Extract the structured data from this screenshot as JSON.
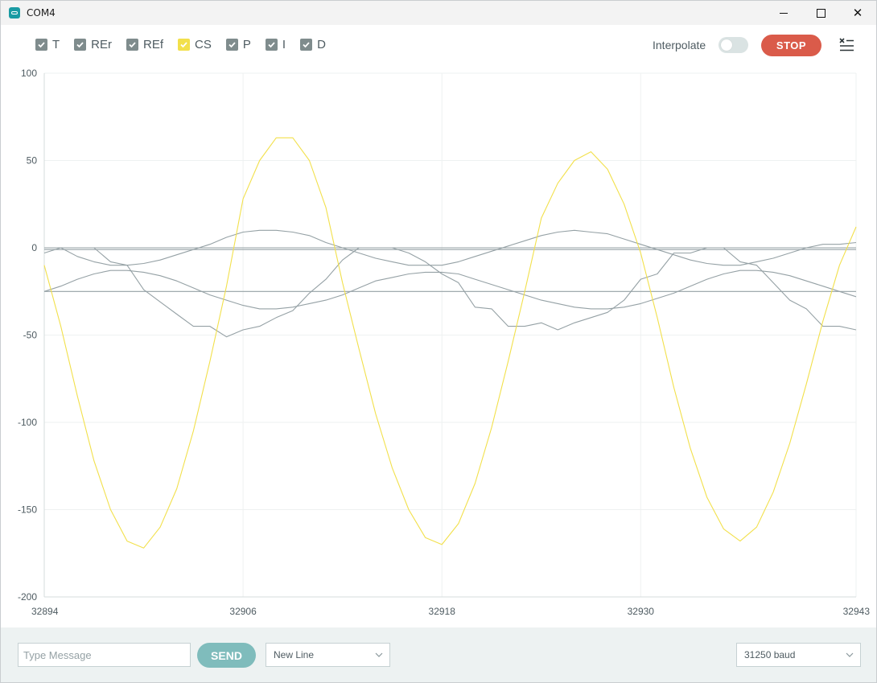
{
  "window": {
    "title": "COM4"
  },
  "legend": [
    {
      "label": "T",
      "checked": true,
      "color": "#7f8c8d"
    },
    {
      "label": "REr",
      "checked": true,
      "color": "#7f8c8d"
    },
    {
      "label": "REf",
      "checked": true,
      "color": "#7f8c8d"
    },
    {
      "label": "CS",
      "checked": true,
      "color": "#f2e04b"
    },
    {
      "label": "P",
      "checked": true,
      "color": "#7f8c8d"
    },
    {
      "label": "I",
      "checked": true,
      "color": "#7f8c8d"
    },
    {
      "label": "D",
      "checked": true,
      "color": "#7f8c8d"
    }
  ],
  "toolbar": {
    "interpolate_label": "Interpolate",
    "interpolate_on": false,
    "stop_label": "STOP"
  },
  "colors": {
    "accent_stop": "#da5b4a",
    "send": "#7fbcbc",
    "cs_line": "#f2e04b",
    "gray_line": "#95a1a5"
  },
  "bottom": {
    "message_placeholder": "Type Message",
    "send_label": "SEND",
    "line_ending": "New Line",
    "baud": "31250 baud"
  },
  "chart_data": {
    "type": "line",
    "xlim": [
      32894,
      32943
    ],
    "ylim": [
      -200,
      100
    ],
    "x_ticks": [
      "32894",
      "32906",
      "32918",
      "32930",
      "32943"
    ],
    "y_ticks": [
      "100",
      "50",
      "0",
      "-50",
      "-100",
      "-150",
      "-200"
    ],
    "grid": true,
    "series": [
      {
        "name": "CS",
        "color": "#f2e04b",
        "x": [
          32894,
          32895,
          32896,
          32897,
          32898,
          32899,
          32900,
          32901,
          32902,
          32903,
          32904,
          32905,
          32906,
          32907,
          32908,
          32909,
          32910,
          32911,
          32912,
          32913,
          32914,
          32915,
          32916,
          32917,
          32918,
          32919,
          32920,
          32921,
          32922,
          32923,
          32924,
          32925,
          32926,
          32927,
          32928,
          32929,
          32930,
          32931,
          32932,
          32933,
          32934,
          32935,
          32936,
          32937,
          32938,
          32939,
          32940,
          32941,
          32942,
          32943
        ],
        "values": [
          -10,
          -45,
          -85,
          -122,
          -150,
          -168,
          -172,
          -160,
          -138,
          -105,
          -65,
          -22,
          28,
          50,
          63,
          63,
          50,
          23,
          -20,
          -58,
          -95,
          -126,
          -150,
          -166,
          -170,
          -158,
          -135,
          -103,
          -65,
          -25,
          17,
          37,
          50,
          55,
          45,
          25,
          -3,
          -40,
          -80,
          -115,
          -143,
          -161,
          -168,
          -160,
          -140,
          -112,
          -78,
          -42,
          -10,
          12
        ],
        "note": ""
      },
      {
        "name": "T",
        "color": "#95a1a5",
        "x": [
          32894,
          32943
        ],
        "values": [
          0,
          0
        ]
      },
      {
        "name": "REr",
        "color": "#95a1a5",
        "x": [
          32894,
          32943
        ],
        "values": [
          -25,
          -25
        ]
      },
      {
        "name": "REf",
        "color": "#95a1a5",
        "x": [
          32894,
          32895,
          32896,
          32897,
          32898,
          32899,
          32900,
          32901,
          32902,
          32903,
          32904,
          32905,
          32906,
          32907,
          32908,
          32909,
          32910,
          32911,
          32912,
          32913,
          32914,
          32915,
          32916,
          32917,
          32918,
          32919,
          32920,
          32921,
          32922,
          32923,
          32924,
          32925,
          32926,
          32927,
          32928,
          32929,
          32930,
          32931,
          32932,
          32933,
          32934,
          32935,
          32936,
          32937,
          32938,
          32939,
          32940,
          32941,
          32942,
          32943
        ],
        "values": [
          -3,
          0,
          -5,
          -8,
          -10,
          -10,
          -9,
          -7,
          -4,
          -1,
          2,
          6,
          9,
          10,
          10,
          9,
          7,
          3,
          0,
          -3,
          -6,
          -8,
          -10,
          -10,
          -10,
          -8,
          -5,
          -2,
          1,
          4,
          7,
          9,
          10,
          9,
          8,
          5,
          2,
          -1,
          -4,
          -7,
          -9,
          -10,
          -10,
          -8,
          -6,
          -3,
          0,
          2,
          2,
          3
        ]
      },
      {
        "name": "P",
        "color": "#95a1a5",
        "x": [
          32894,
          32895,
          32896,
          32897,
          32898,
          32899,
          32900,
          32901,
          32902,
          32903,
          32904,
          32905,
          32906,
          32907,
          32908,
          32909,
          32910,
          32911,
          32912,
          32913,
          32914,
          32915,
          32916,
          32917,
          32918,
          32919,
          32920,
          32921,
          32922,
          32923,
          32924,
          32925,
          32926,
          32927,
          32928,
          32929,
          32930,
          32931,
          32932,
          32933,
          32934,
          32935,
          32936,
          32937,
          32938,
          32939,
          32940,
          32941,
          32942,
          32943
        ],
        "values": [
          -25,
          -22,
          -18,
          -15,
          -13,
          -13,
          -14,
          -16,
          -19,
          -23,
          -27,
          -30,
          -33,
          -35,
          -35,
          -34,
          -32,
          -30,
          -27,
          -23,
          -19,
          -17,
          -15,
          -14,
          -14,
          -15,
          -18,
          -21,
          -24,
          -27,
          -30,
          -32,
          -34,
          -35,
          -35,
          -34,
          -32,
          -29,
          -26,
          -22,
          -18,
          -15,
          -13,
          -13,
          -14,
          -16,
          -19,
          -22,
          -25,
          -28
        ]
      },
      {
        "name": "I",
        "color": "#95a1a5",
        "x": [
          32894,
          32895,
          32896,
          32897,
          32898,
          32899,
          32900,
          32901,
          32902,
          32903,
          32904,
          32905,
          32906,
          32907,
          32908,
          32909,
          32910,
          32911,
          32912,
          32913,
          32914,
          32915,
          32916,
          32917,
          32918,
          32919,
          32920,
          32921,
          32922,
          32923,
          32924,
          32925,
          32926,
          32927,
          32928,
          32929,
          32930,
          32931,
          32932,
          32933,
          32934,
          32935,
          32936,
          32937,
          32938,
          32939,
          32940,
          32941,
          32942,
          32943
        ],
        "values": [
          0,
          0,
          0,
          0,
          -8,
          -10,
          -24,
          -31,
          -38,
          -45,
          -45,
          -51,
          -47,
          -45,
          -40,
          -36,
          -26,
          -18,
          -7,
          0,
          0,
          0,
          -3,
          -8,
          -15,
          -20,
          -34,
          -35,
          -45,
          -45,
          -43,
          -47,
          -43,
          -40,
          -37,
          -30,
          -18,
          -15,
          -3,
          -3,
          0,
          0,
          -8,
          -10,
          -20,
          -30,
          -35,
          -45,
          -45,
          -47
        ]
      },
      {
        "name": "D",
        "color": "#95a1a5",
        "x": [
          32894,
          32943
        ],
        "values": [
          -1,
          -1
        ]
      }
    ]
  }
}
